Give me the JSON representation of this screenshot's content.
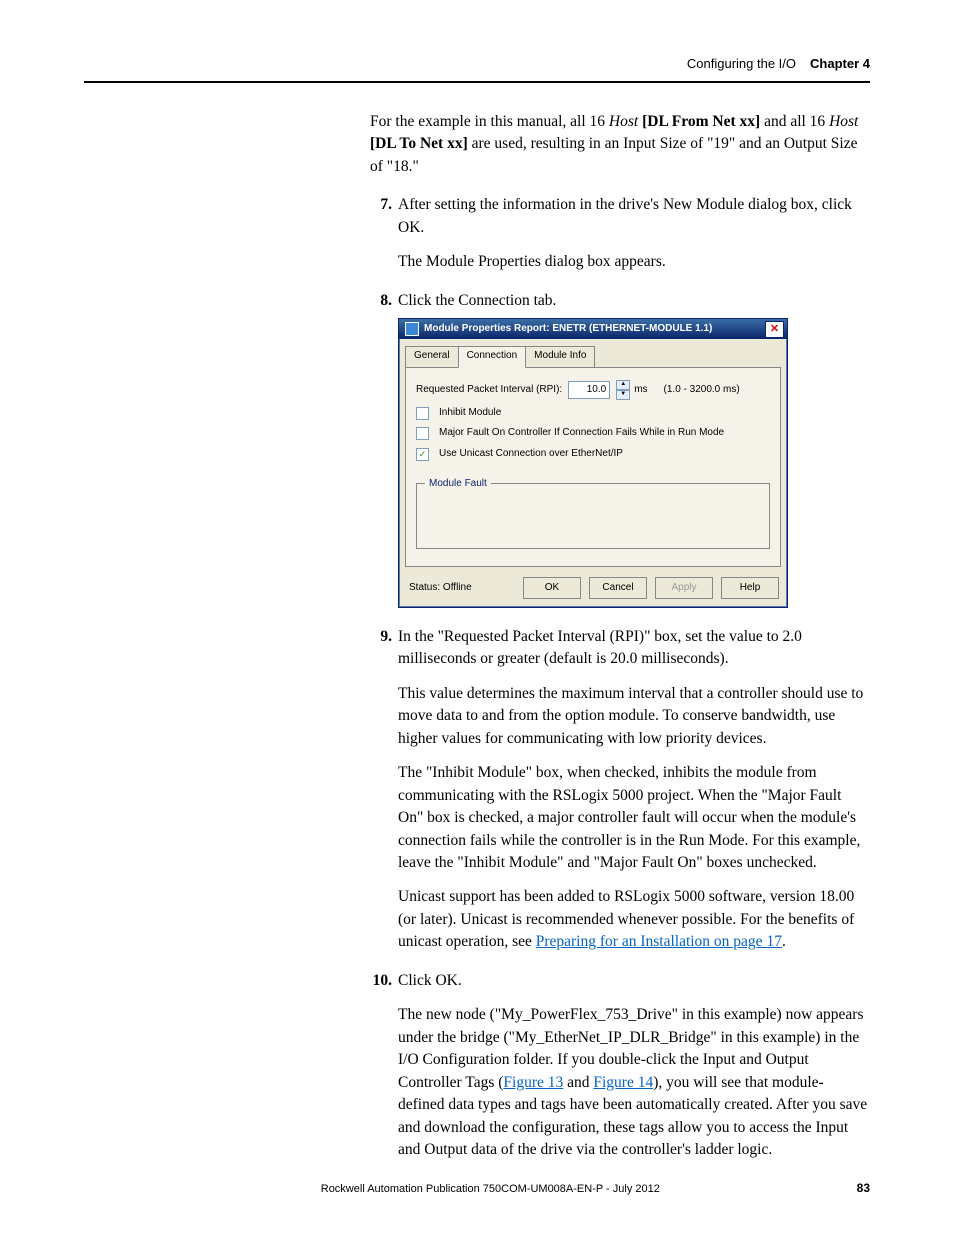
{
  "header": {
    "title": "Configuring the I/O",
    "chapter": "Chapter 4"
  },
  "intro": {
    "p1a": "For the example in this manual, all 16 ",
    "p1_host": "Host",
    "p1b": " ",
    "p1_dl_from": "[DL From Net xx]",
    "p1c": " and all 16 ",
    "p1_dl_to": "[DL To Net xx]",
    "p1d": " are used, resulting in an Input Size of \"19\" and an Output Size of \"18.\""
  },
  "steps": {
    "s7": {
      "num": "7.",
      "text": "After setting the information in the drive's New Module dialog box, click OK.",
      "sub": "The Module Properties dialog box appears."
    },
    "s8": {
      "num": "8.",
      "text": "Click the Connection tab."
    },
    "s9": {
      "num": "9.",
      "text": "In the \"Requested Packet Interval (RPI)\" box, set the value to 2.0 milliseconds or greater (default is 20.0 milliseconds).",
      "sub1": "This value determines the maximum interval that a controller should use to move data to and from the option module. To conserve bandwidth, use higher values for communicating with low priority devices.",
      "sub2": "The \"Inhibit Module\" box, when checked, inhibits the module from communicating with the RSLogix 5000 project. When the \"Major Fault On\" box is checked, a major controller fault will occur when the module's connection fails while the controller is in the Run Mode. For this example, leave the \"Inhibit Module\" and \"Major Fault On\" boxes unchecked.",
      "sub3a": "Unicast support has been added to RSLogix 5000 software, version 18.00 (or later). Unicast is recommended whenever possible. For the benefits of unicast operation, see ",
      "sub3_link": "Preparing for an Installation on page 17",
      "sub3b": "."
    },
    "s10": {
      "num": "10.",
      "text": "Click OK.",
      "sub1a": "The new node (\"My_PowerFlex_753_Drive\" in this example) now appears under the bridge (\"My_EtherNet_IP_DLR_Bridge\" in this example) in the I/O Configuration folder. If you double-click the Input and Output Controller Tags (",
      "fig13": "Figure 13",
      "sub1b": " and ",
      "fig14": "Figure 14",
      "sub1c": "), you will see that module-defined data types and tags have been automatically created. After you save and download the configuration, these tags allow you to access the Input and Output data of the drive via the controller's ladder logic."
    }
  },
  "dialog": {
    "title": "Module Properties Report: ENETR (ETHERNET-MODULE 1.1)",
    "tabs": {
      "general": "General",
      "connection": "Connection",
      "module_info": "Module Info"
    },
    "rpi_label": "Requested Packet Interval (RPI):",
    "rpi_value": "10.0",
    "rpi_unit": "ms",
    "rpi_range": "(1.0 - 3200.0 ms)",
    "inhibit": "Inhibit Module",
    "major_fault": "Major Fault On Controller If Connection Fails While in Run Mode",
    "unicast": "Use Unicast Connection over EtherNet/IP",
    "module_fault": "Module Fault",
    "status_label": "Status:",
    "status_value": "Offline",
    "buttons": {
      "ok": "OK",
      "cancel": "Cancel",
      "apply": "Apply",
      "help": "Help"
    }
  },
  "footer": {
    "publication": "Rockwell Automation Publication 750COM-UM008A-EN-P - July 2012",
    "page": "83"
  }
}
